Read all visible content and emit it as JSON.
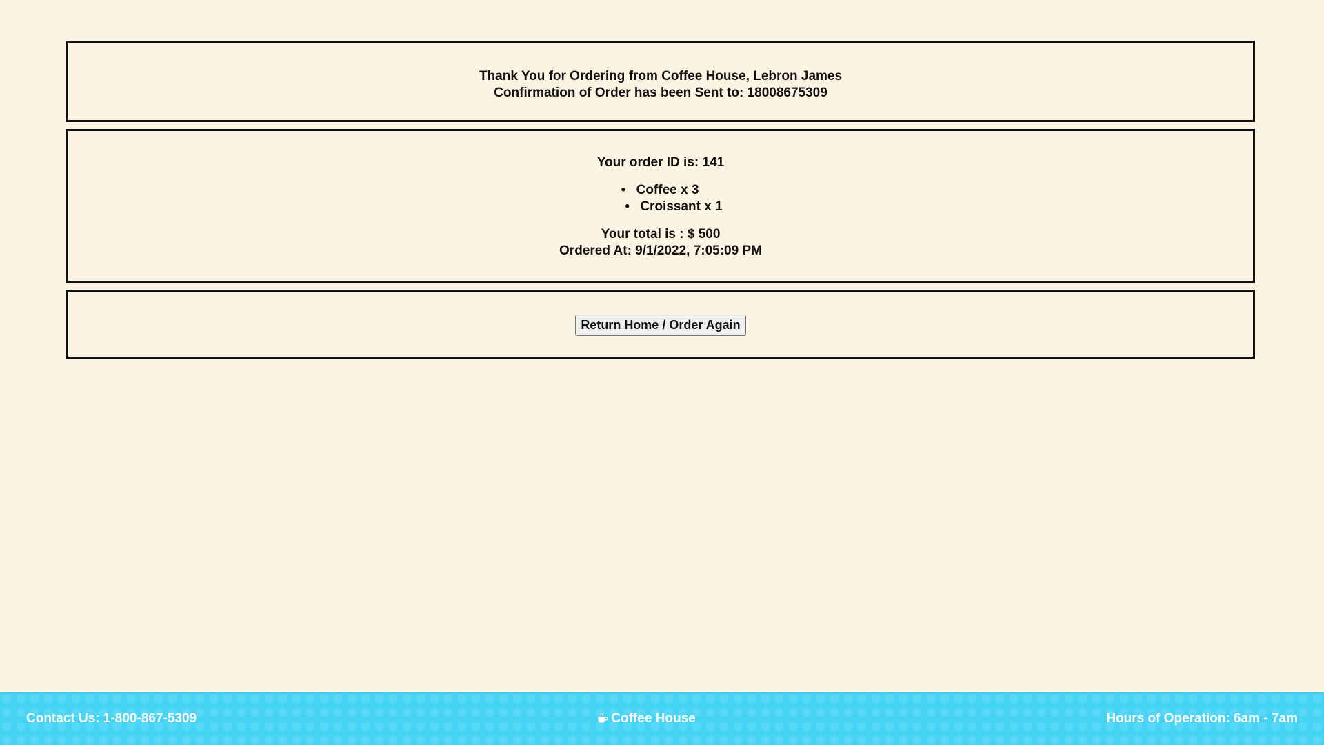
{
  "confirmation": {
    "thanks_line": "Thank You for Ordering from Coffee House, Lebron James",
    "sent_to_line": "Confirmation of Order has been Sent to: 18008675309"
  },
  "order": {
    "id_line": "Your order ID is: 141",
    "items": [
      {
        "label": "Coffee x 3"
      },
      {
        "label": "Croissant x 1"
      }
    ],
    "total_line": "Your total is : $ 500",
    "ordered_at_line": "Ordered At: 9/1/2022, 7:05:09 PM"
  },
  "actions": {
    "return_label": "Return Home / Order Again"
  },
  "footer": {
    "contact": "Contact Us: 1-800-867-5309",
    "brand": "Coffee House",
    "brand_icon": "coffee-cup-icon",
    "hours": "Hours of Operation: 6am - 7am"
  },
  "colors": {
    "background": "#fdf3e2",
    "footer": "#45d4f5",
    "border": "#111111"
  }
}
